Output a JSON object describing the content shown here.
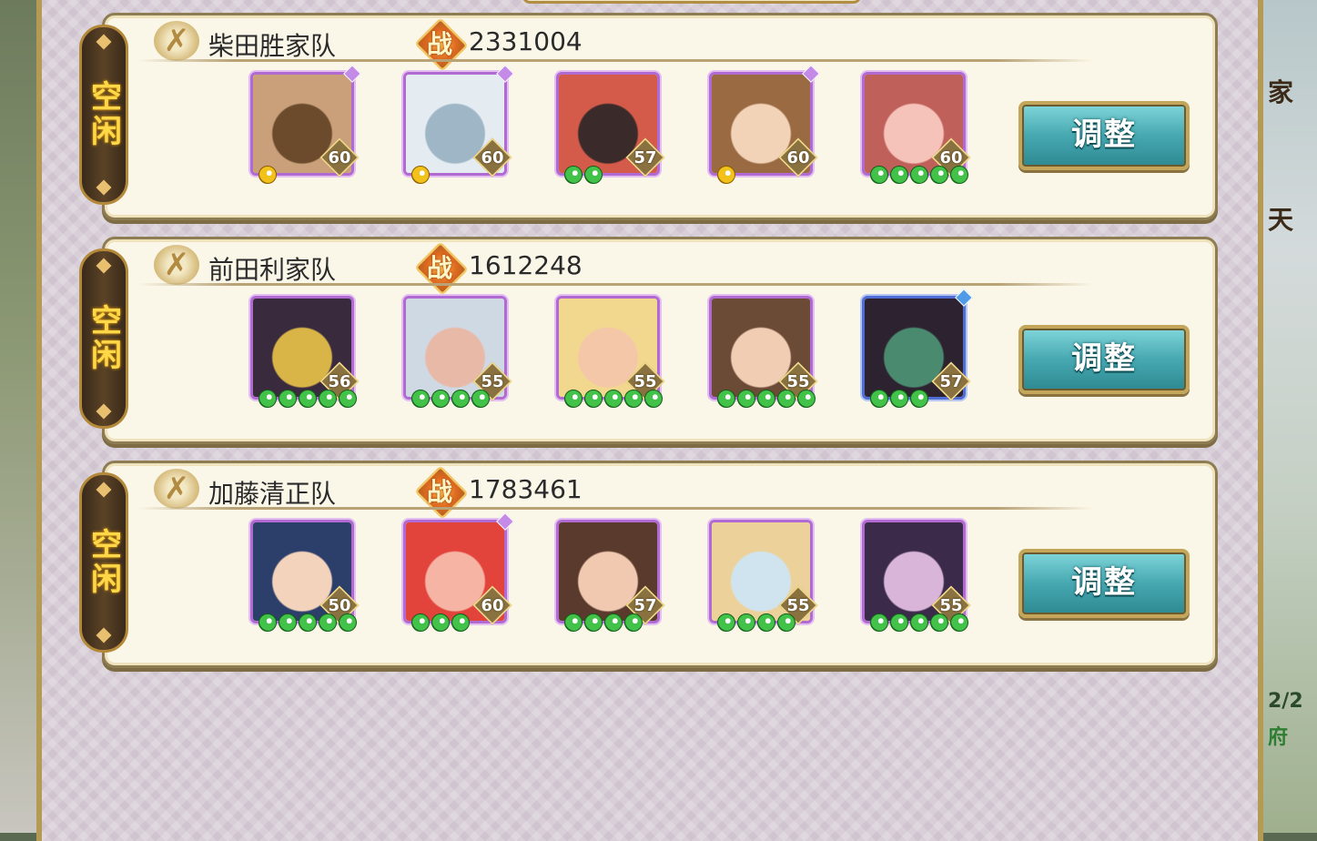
{
  "side_right": {
    "tag_1": "家",
    "tag_2": "天",
    "counter": "2/2",
    "fu": "府"
  },
  "teams": [
    {
      "status": "空闲",
      "name": "柴田胜家队",
      "power_icon": "战",
      "power": "2331004",
      "adjust_label": "调整",
      "heroes": [
        {
          "level": "60",
          "stars": 1,
          "star_color": "gold",
          "frame": "purple",
          "gem": true,
          "colors": [
            "#caa07a",
            "#6b4b2b"
          ]
        },
        {
          "level": "60",
          "stars": 1,
          "star_color": "gold",
          "frame": "purple",
          "gem": true,
          "colors": [
            "#e4ecf2",
            "#9fb6c7"
          ]
        },
        {
          "level": "57",
          "stars": 2,
          "star_color": "green",
          "frame": "purple",
          "gem": false,
          "colors": [
            "#d45a4a",
            "#3b2a2a"
          ]
        },
        {
          "level": "60",
          "stars": 1,
          "star_color": "gold",
          "frame": "purple",
          "gem": true,
          "colors": [
            "#9a6a42",
            "#f2d3b7"
          ]
        },
        {
          "level": "60",
          "stars": 5,
          "star_color": "green",
          "frame": "purple",
          "gem": false,
          "colors": [
            "#c0605a",
            "#f6c3bb"
          ]
        }
      ]
    },
    {
      "status": "空闲",
      "name": "前田利家队",
      "power_icon": "战",
      "power": "1612248",
      "adjust_label": "调整",
      "heroes": [
        {
          "level": "56",
          "stars": 5,
          "star_color": "green",
          "frame": "purple",
          "gem": false,
          "colors": [
            "#3a2a3e",
            "#d9b548"
          ]
        },
        {
          "level": "55",
          "stars": 4,
          "star_color": "green",
          "frame": "purple",
          "gem": false,
          "colors": [
            "#cfd9e4",
            "#e9b9a8"
          ]
        },
        {
          "level": "55",
          "stars": 5,
          "star_color": "green",
          "frame": "purple",
          "gem": false,
          "colors": [
            "#f1d88e",
            "#f4c7a8"
          ]
        },
        {
          "level": "55",
          "stars": 5,
          "star_color": "green",
          "frame": "purple",
          "gem": false,
          "colors": [
            "#6b4a36",
            "#f1cdb4"
          ]
        },
        {
          "level": "57",
          "stars": 3,
          "star_color": "green",
          "frame": "blue",
          "gem": true,
          "colors": [
            "#2d2230",
            "#4a8a6f"
          ]
        }
      ]
    },
    {
      "status": "空闲",
      "name": "加藤清正队",
      "power_icon": "战",
      "power": "1783461",
      "adjust_label": "调整",
      "heroes": [
        {
          "level": "50",
          "stars": 5,
          "star_color": "green",
          "frame": "purple",
          "gem": false,
          "colors": [
            "#2c3f6b",
            "#f3d3bb"
          ]
        },
        {
          "level": "60",
          "stars": 3,
          "star_color": "green",
          "frame": "purple",
          "gem": true,
          "colors": [
            "#e2443c",
            "#f6b4a4"
          ]
        },
        {
          "level": "57",
          "stars": 4,
          "star_color": "green",
          "frame": "purple",
          "gem": false,
          "colors": [
            "#5a3a2c",
            "#f1c9b1"
          ]
        },
        {
          "level": "55",
          "stars": 4,
          "star_color": "green",
          "frame": "purple",
          "gem": false,
          "colors": [
            "#ecd29a",
            "#cfe4ee"
          ]
        },
        {
          "level": "55",
          "stars": 5,
          "star_color": "green",
          "frame": "purple",
          "gem": false,
          "colors": [
            "#3b2a4a",
            "#d9b6d9"
          ]
        }
      ]
    }
  ]
}
